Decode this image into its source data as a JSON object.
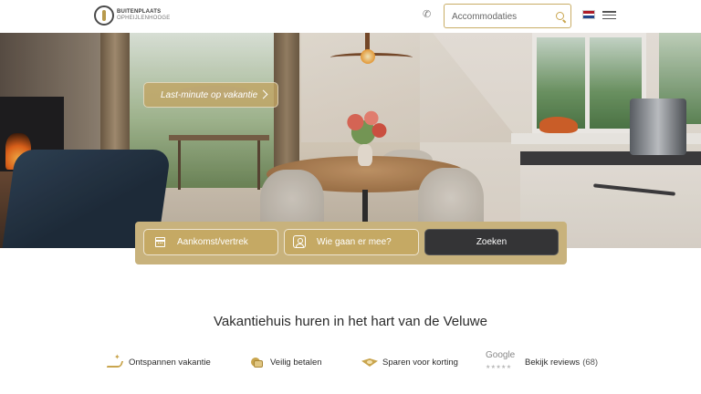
{
  "header": {
    "logo": {
      "line1": "BUITENPLAATS",
      "line2": "OPHEIJLENHOOGE"
    },
    "phone_icon": "phone-icon",
    "search": {
      "placeholder": "Accommodaties",
      "icon": "search-icon"
    },
    "language_flag": {
      "name": "flag-nl-icon",
      "colors": [
        "#ae1c28",
        "#ffffff",
        "#21468b"
      ]
    },
    "menu_icon": "hamburger-menu-icon"
  },
  "hero": {
    "promo_label": "Last-minute op vakantie"
  },
  "booking": {
    "date_label": "Aankomst/vertrek",
    "guests_label": "Wie gaan er mee?",
    "search_label": "Zoeken"
  },
  "main": {
    "title": "Vakantiehuis huren in het hart van de Veluwe"
  },
  "usps": [
    {
      "icon": "relax-icon",
      "label": "Ontspannen vakantie"
    },
    {
      "icon": "secure-payment-icon",
      "label": "Veilig betalen"
    },
    {
      "icon": "discount-icon",
      "label": "Sparen voor korting"
    }
  ],
  "reviews": {
    "google_label": "Google",
    "stars": "★★★★★",
    "label": "Bekijk reviews",
    "count": "(68)"
  },
  "colors": {
    "accent_gold": "#c8b27c",
    "dark_button": "#343436"
  }
}
